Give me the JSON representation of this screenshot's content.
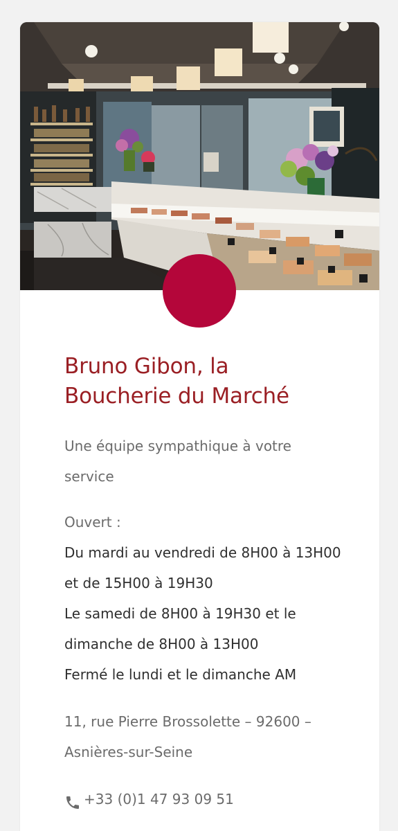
{
  "card": {
    "image": {
      "alt": "Intérieur de la boucherie",
      "icon": "shop-interior-photo"
    },
    "badge_color": "#b4063a",
    "title": "Bruno Gibon, la Boucherie du Marché",
    "tagline": "Une équipe sympathique à votre service",
    "hours": {
      "label": "Ouvert :",
      "lines": [
        "Du mardi au vendredi de 8H00 à 13H00 et de 15H00 à 19H30",
        "Le samedi de 8H00 à 19H30 et le dimanche de 8H00 à 13H00",
        "Fermé le lundi et le dimanche AM"
      ]
    },
    "address": "11, rue Pierre Brossolette – 92600 – Asnières-sur-Seine",
    "phone": {
      "icon": "phone-icon",
      "number": "+33 (0)1 47 93 09 51"
    }
  },
  "colors": {
    "title": "#9a1f24",
    "badge": "#b4063a",
    "muted_text": "#6b6b6b",
    "body_text": "#2f2f2f",
    "page_bg": "#f2f2f2",
    "card_bg": "#ffffff"
  }
}
